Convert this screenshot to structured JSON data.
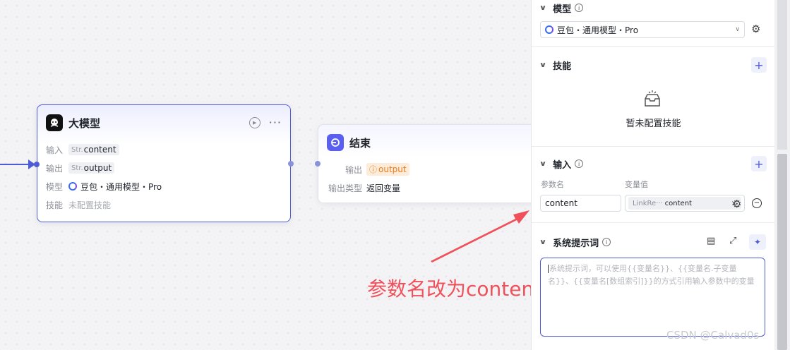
{
  "llm_node": {
    "title": "大模型",
    "input_label": "输入",
    "input_type": "Str.",
    "input_value": "content",
    "output_label": "输出",
    "output_type": "Str.",
    "output_value": "output",
    "model_label": "模型",
    "model_value": "豆包・通用模型・Pro",
    "skill_label": "技能",
    "skill_value": "未配置技能"
  },
  "end_node": {
    "title": "结束",
    "output_label": "输出",
    "output_value": "output",
    "output_type_label": "输出类型",
    "output_type_value": "返回变量"
  },
  "annotation": "参数名改为content",
  "panel": {
    "model_section": {
      "title": "模型",
      "selected": "豆包・通用模型・Pro"
    },
    "skills_section": {
      "title": "技能",
      "empty_text": "暂未配置技能"
    },
    "input_section": {
      "title": "输入",
      "param_name_header": "参数名",
      "var_value_header": "变量值",
      "param_name": "content",
      "ref_source": "LinkRe···",
      "ref_field": "content"
    },
    "system_prompt_section": {
      "title": "系统提示词",
      "placeholder": "系统提示词，可以使用{{变量名}}、{{变量名.子变量名}}、{{变量名[数组索引]}}的方式引用输入参数中的变量"
    }
  },
  "watermark": "CSDN @Calvad0s",
  "colors": {
    "accent": "#4e5bd6",
    "annotation": "#f0505a",
    "warning": "#e87b1e"
  }
}
